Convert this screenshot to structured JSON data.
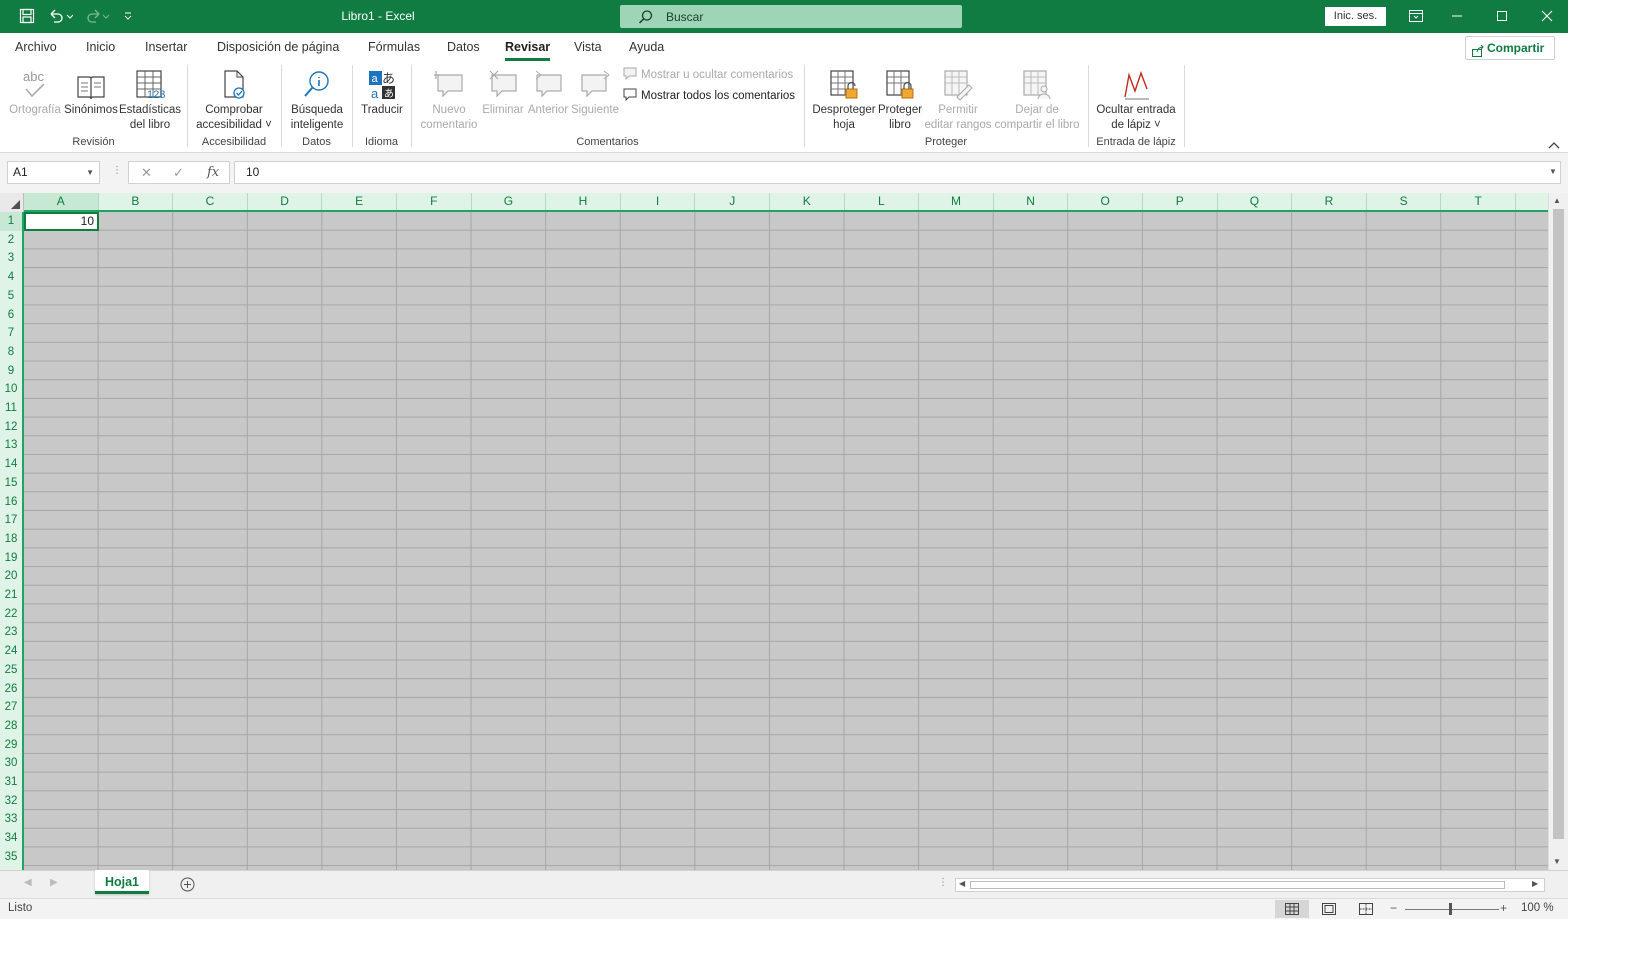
{
  "window": {
    "title": "Libro1  -  Excel",
    "search_placeholder": "Buscar",
    "signin_label": "Inic. ses.",
    "theme_color": "#107c41"
  },
  "tabs": [
    "Archivo",
    "Inicio",
    "Insertar",
    "Disposición de página",
    "Fórmulas",
    "Datos",
    "Revisar",
    "Vista",
    "Ayuda"
  ],
  "active_tab": "Revisar",
  "share_label": "Compartir",
  "ribbon": {
    "revision": {
      "group": "Revisión",
      "ortografia": "Ortografía",
      "sinonimos": "Sinónimos",
      "estadisticas_1": "Estadísticas",
      "estadisticas_2": "del libro"
    },
    "accesibilidad": {
      "group": "Accesibilidad",
      "comprobar_1": "Comprobar",
      "comprobar_2": "accesibilidad ˅"
    },
    "datos": {
      "group": "Datos",
      "busqueda_1": "Búsqueda",
      "busqueda_2": "inteligente"
    },
    "idioma": {
      "group": "Idioma",
      "traducir": "Traducir"
    },
    "comentarios": {
      "group": "Comentarios",
      "nuevo_1": "Nuevo",
      "nuevo_2": "comentario",
      "eliminar": "Eliminar",
      "anterior": "Anterior",
      "siguiente": "Siguiente",
      "mostrar_ocultar": "Mostrar u ocultar comentarios",
      "mostrar_todos": "Mostrar todos los comentarios"
    },
    "proteger": {
      "group": "Proteger",
      "desproteger_1": "Desproteger",
      "desproteger_2": "hoja",
      "proteger_1": "Proteger",
      "proteger_2": "libro",
      "permitir_1": "Permitir",
      "permitir_2": "editar rangos",
      "dejar_1": "Dejar de",
      "dejar_2": "compartir el libro"
    },
    "lapiz": {
      "group": "Entrada de lápiz",
      "ocultar_1": "Ocultar entrada",
      "ocultar_2": "de lápiz ˅"
    }
  },
  "formula_bar": {
    "name_box": "A1",
    "fx": "fx",
    "formula": "10"
  },
  "grid": {
    "columns": [
      "A",
      "B",
      "C",
      "D",
      "E",
      "F",
      "G",
      "H",
      "I",
      "J",
      "K",
      "L",
      "M",
      "N",
      "O",
      "P",
      "Q",
      "R",
      "S",
      "T"
    ],
    "rows": [
      "1",
      "2",
      "3",
      "4",
      "5",
      "6",
      "7",
      "8",
      "9",
      "10",
      "11",
      "12",
      "13",
      "14",
      "15",
      "16",
      "17",
      "18",
      "19",
      "20",
      "21",
      "22",
      "23",
      "24",
      "25",
      "26",
      "27",
      "28",
      "29",
      "30",
      "31",
      "32",
      "33",
      "34",
      "35"
    ],
    "cell_A1": "10"
  },
  "sheet_tab": "Hoja1",
  "status": {
    "text": "Listo",
    "zoom": "100 %"
  }
}
